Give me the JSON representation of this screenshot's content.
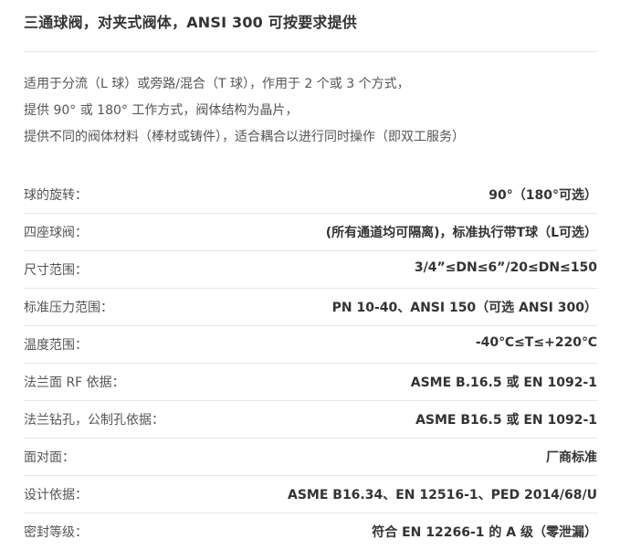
{
  "title": "三通球阀，对夹式阀体，ANSI 300 可按要求提供",
  "intro": [
    "适用于分流（L 球）或旁路/混合（T 球），作用于 2 个或 3 个方式，",
    "提供 90° 或 180° 工作方式，阀体结构为晶片，",
    "提供不同的阀体材料（棒材或铸件），适合耦合以进行同时操作（即双工服务）"
  ],
  "specs": [
    {
      "label": "球的旋转：",
      "value": "90°（180°可选）"
    },
    {
      "label": "四座球阀：",
      "value": "(所有通道均可隔离)，标准执行带T球（L可选）"
    },
    {
      "label": "尺寸范围：",
      "value": "3/4”≤DN≤6”/20≤DN≤150"
    },
    {
      "label": "标准压力范围：",
      "value": "PN 10-40、ANSI 150（可选 ANSI 300）"
    },
    {
      "label": "温度范围：",
      "value": "-40℃≤T≤+220℃"
    },
    {
      "label": "法兰面 RF 依据：",
      "value": "ASME B.16.5 或 EN 1092-1"
    },
    {
      "label": "法兰钻孔，公制孔依据：",
      "value": "ASME B16.5 或 EN 1092-1"
    },
    {
      "label": "面对面：",
      "value": "厂商标准"
    },
    {
      "label": "设计依据：",
      "value": "ASME B16.34、EN 12516-1、PED 2014/68/U"
    },
    {
      "label": "密封等级：",
      "value": "符合 EN 12266-1 的 A 级（零泄漏）"
    }
  ]
}
